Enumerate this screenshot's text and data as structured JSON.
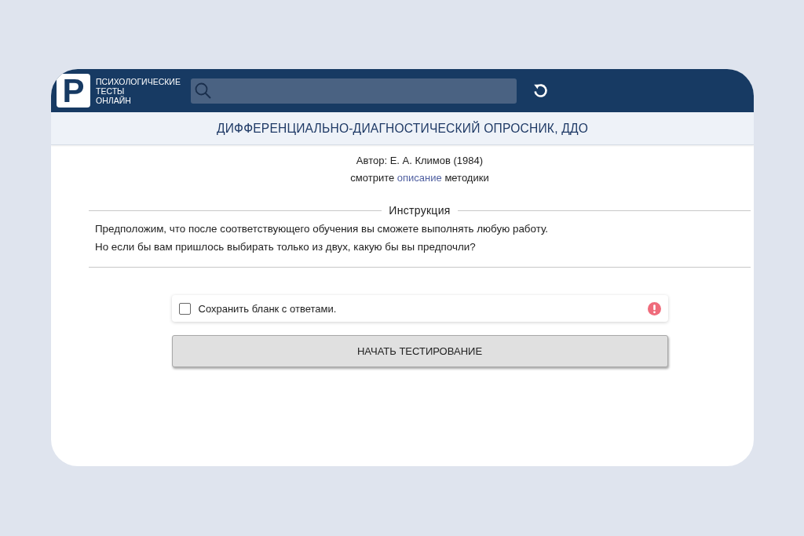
{
  "header": {
    "logo_letter": "P",
    "site_name": [
      "ПСИХОЛОГИЧЕСКИЕ",
      "ТЕСТЫ",
      "ОНЛАЙН"
    ]
  },
  "title": "ДИФФЕРЕНЦИАЛЬНО-ДИАГНОСТИЧЕСКИЙ ОПРОСНИК, ДДО",
  "author": "Автор: Е. А. Климов (1984)",
  "description_line": {
    "before": "смотрите",
    "link": "описание",
    "after": "методики"
  },
  "instruction": {
    "legend": "Инструкция",
    "lines": [
      "Предположим, что после соответствующего обучения вы сможете выполнять любую работу.",
      "Но если бы вам пришлось выбирать только из двух, какую бы вы предпочли?"
    ]
  },
  "save_option": {
    "label": "Сохранить бланк с ответами.",
    "checked": false,
    "warning": true
  },
  "start_button": "НАЧАТЬ ТЕСТИРОВАНИЕ"
}
